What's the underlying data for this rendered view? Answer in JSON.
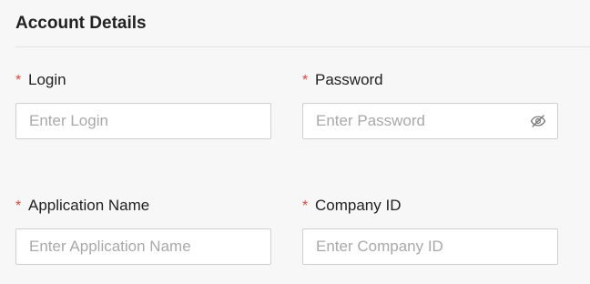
{
  "section": {
    "title": "Account Details"
  },
  "form": {
    "required_marker": "*",
    "login": {
      "label": "Login",
      "placeholder": "Enter Login",
      "value": ""
    },
    "password": {
      "label": "Password",
      "placeholder": "Enter Password",
      "value": "",
      "toggle_icon": "eye-slash-icon"
    },
    "application_name": {
      "label": "Application Name",
      "placeholder": "Enter Application Name",
      "value": ""
    },
    "company_id": {
      "label": "Company ID",
      "placeholder": "Enter Company ID",
      "value": ""
    }
  },
  "colors": {
    "required": "#e0483e",
    "border": "#cfcfcf",
    "background": "#f7f7f7",
    "placeholder": "#a9a9a9"
  }
}
